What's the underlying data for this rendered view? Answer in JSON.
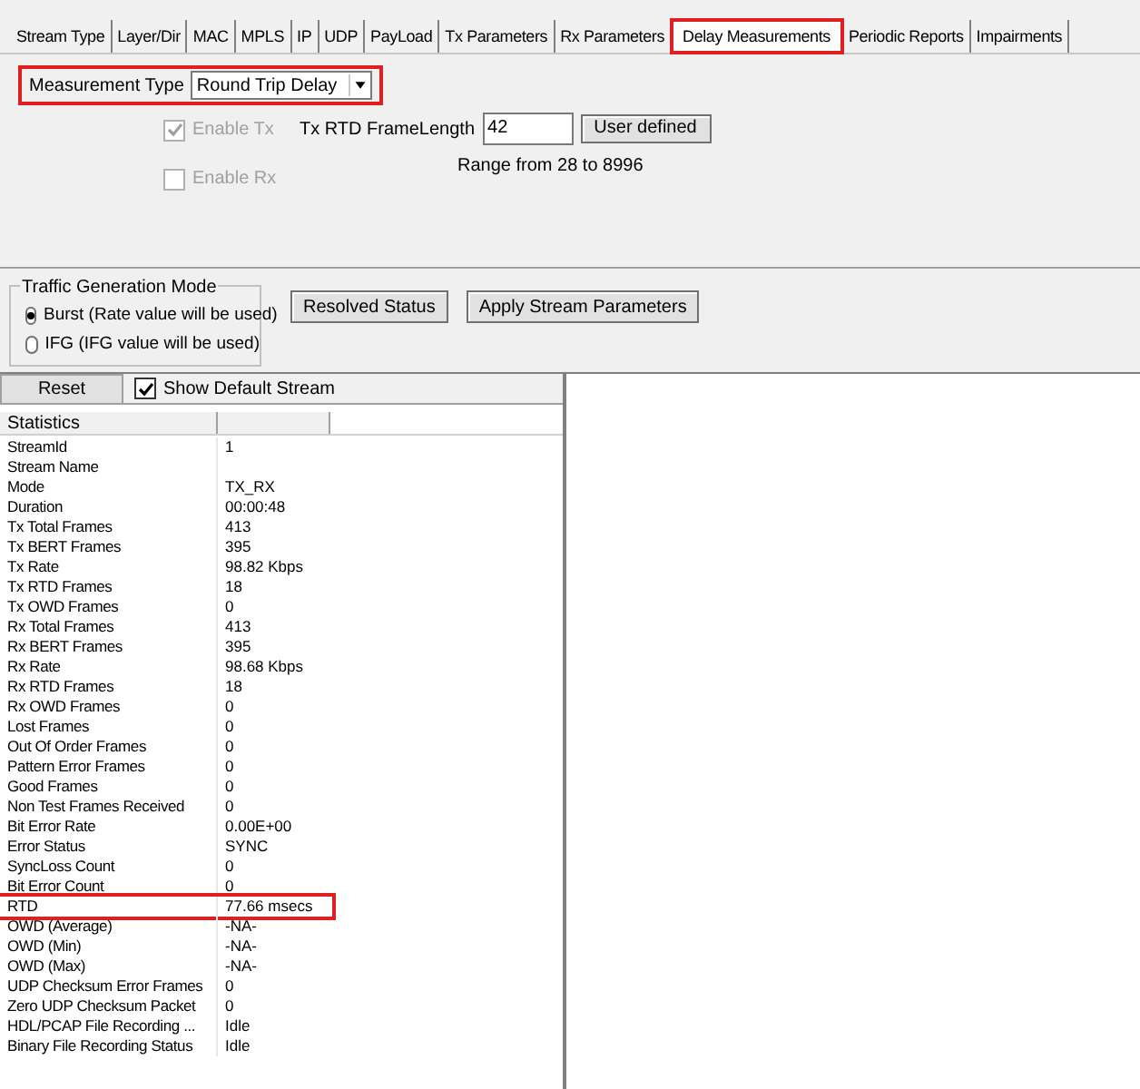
{
  "tabs": [
    {
      "label": "Stream Type",
      "selected": false,
      "highlighted": false
    },
    {
      "label": "Layer/Dir",
      "selected": false,
      "highlighted": false
    },
    {
      "label": "MAC",
      "selected": false,
      "highlighted": false
    },
    {
      "label": "MPLS",
      "selected": false,
      "highlighted": false
    },
    {
      "label": "IP",
      "selected": false,
      "highlighted": false
    },
    {
      "label": "UDP",
      "selected": false,
      "highlighted": false
    },
    {
      "label": "PayLoad",
      "selected": false,
      "highlighted": false
    },
    {
      "label": "Tx Parameters",
      "selected": false,
      "highlighted": false
    },
    {
      "label": "Rx Parameters",
      "selected": false,
      "highlighted": false
    },
    {
      "label": "Delay Measurements",
      "selected": true,
      "highlighted": true
    },
    {
      "label": "Periodic Reports",
      "selected": false,
      "highlighted": false
    },
    {
      "label": "Impairments",
      "selected": false,
      "highlighted": false
    }
  ],
  "measurement_type": {
    "label": "Measurement Type",
    "value": "Round Trip Delay",
    "highlighted": true
  },
  "enable_tx": {
    "label": "Enable Tx",
    "checked": true,
    "disabled": true
  },
  "enable_rx": {
    "label": "Enable Rx",
    "checked": false,
    "disabled": true
  },
  "frame_length": {
    "label": "Tx RTD FrameLength",
    "value": "42",
    "button": "User defined",
    "range": "Range from 28 to 8996"
  },
  "traffic_mode": {
    "title": "Traffic Generation Mode",
    "options": [
      {
        "label": "Burst (Rate value will be used)",
        "selected": true
      },
      {
        "label": "IFG (IFG value will be used)",
        "selected": false
      }
    ]
  },
  "buttons": [
    "Resolved Status",
    "Apply Stream Parameters"
  ],
  "stats_toolbar": {
    "reset": "Reset",
    "show_default": {
      "label": "Show Default Stream",
      "checked": true
    }
  },
  "table": {
    "columns": [
      "Statistics"
    ],
    "rows": [
      {
        "name": "StreamId",
        "value": "1",
        "highlighted": false
      },
      {
        "name": "Stream Name",
        "value": "",
        "highlighted": false
      },
      {
        "name": "Mode",
        "value": "TX_RX",
        "highlighted": false
      },
      {
        "name": "Duration",
        "value": "00:00:48",
        "highlighted": false
      },
      {
        "name": "Tx Total Frames",
        "value": "413",
        "highlighted": false
      },
      {
        "name": "Tx BERT Frames",
        "value": "395",
        "highlighted": false
      },
      {
        "name": "Tx Rate",
        "value": "98.82 Kbps",
        "highlighted": false
      },
      {
        "name": "Tx RTD Frames",
        "value": "18",
        "highlighted": false
      },
      {
        "name": "Tx OWD Frames",
        "value": "0",
        "highlighted": false
      },
      {
        "name": "Rx Total Frames",
        "value": "413",
        "highlighted": false
      },
      {
        "name": "Rx BERT Frames",
        "value": "395",
        "highlighted": false
      },
      {
        "name": "Rx Rate",
        "value": "98.68 Kbps",
        "highlighted": false
      },
      {
        "name": "Rx RTD Frames",
        "value": "18",
        "highlighted": false
      },
      {
        "name": "Rx OWD Frames",
        "value": "0",
        "highlighted": false
      },
      {
        "name": "Lost Frames",
        "value": "0",
        "highlighted": false
      },
      {
        "name": "Out Of Order Frames",
        "value": "0",
        "highlighted": false
      },
      {
        "name": "Pattern Error Frames",
        "value": "0",
        "highlighted": false
      },
      {
        "name": "Good Frames",
        "value": "0",
        "highlighted": false
      },
      {
        "name": "Non Test Frames Received",
        "value": "0",
        "highlighted": false
      },
      {
        "name": "Bit Error Rate",
        "value": "0.00E+00",
        "highlighted": false
      },
      {
        "name": "Error Status",
        "value": "SYNC",
        "highlighted": false
      },
      {
        "name": "SyncLoss Count",
        "value": "0",
        "highlighted": false
      },
      {
        "name": "Bit Error Count",
        "value": "0",
        "highlighted": false
      },
      {
        "name": "RTD",
        "value": "77.66 msecs",
        "highlighted": true
      },
      {
        "name": "OWD (Average)",
        "value": "-NA-",
        "highlighted": false
      },
      {
        "name": "OWD (Min)",
        "value": "-NA-",
        "highlighted": false
      },
      {
        "name": "OWD (Max)",
        "value": "-NA-",
        "highlighted": false
      },
      {
        "name": "UDP Checksum Error Frames",
        "value": "0",
        "highlighted": false
      },
      {
        "name": "Zero UDP Checksum Packet",
        "value": "0",
        "highlighted": false
      },
      {
        "name": "HDL/PCAP File Recording ...",
        "value": "Idle",
        "highlighted": false
      },
      {
        "name": "Binary File Recording Status",
        "value": "Idle",
        "highlighted": false
      }
    ]
  }
}
